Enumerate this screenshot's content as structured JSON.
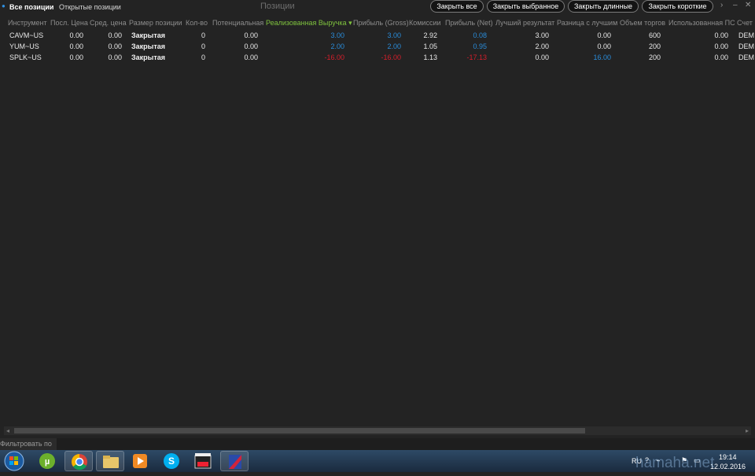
{
  "tabs": [
    {
      "label": "Все позиции"
    },
    {
      "label": "Открытые позиции"
    }
  ],
  "window_title": "Позиции",
  "actions": [
    {
      "label": "Закрыть все"
    },
    {
      "label": "Закрыть выбранное"
    },
    {
      "label": "Закрыть длинные"
    },
    {
      "label": "Закрыть короткие"
    }
  ],
  "columns": [
    "Инструмент",
    "Посл. Цена",
    "Сред. цена",
    "Размер позиции",
    "Кол-во",
    "Потенциальная",
    "Реализованная Выручка",
    "Прибыль (Gross)",
    "Комиссии",
    "Прибыль (Net)",
    "Лучший результат",
    "Разница с лучшим",
    "Объем торгов",
    "Использованная ПС",
    "Счет"
  ],
  "rows": [
    [
      "CAVM~US",
      "0.00",
      "0.00",
      "Закрытая",
      "0",
      "0.00",
      "3.00",
      "3.00",
      "2.92",
      "0.08",
      "3.00",
      "0.00",
      "600",
      "0.00",
      "DEM"
    ],
    [
      "YUM~US",
      "0.00",
      "0.00",
      "Закрытая",
      "0",
      "0.00",
      "2.00",
      "2.00",
      "1.05",
      "0.95",
      "2.00",
      "0.00",
      "200",
      "0.00",
      "DEM"
    ],
    [
      "SPLK~US",
      "0.00",
      "0.00",
      "Закрытая",
      "0",
      "0.00",
      "-16.00",
      "-16.00",
      "1.13",
      "-17.13",
      "0.00",
      "16.00",
      "200",
      "0.00",
      "DEM"
    ]
  ],
  "filter": {
    "label": "Фильтровать по"
  },
  "tray": {
    "lang": "RU",
    "time": "19:14",
    "date": "12.02.2016"
  },
  "watermark": "hamaha.net",
  "colors": {
    "positive": "#2a8bd8",
    "negative": "#d41e2b",
    "sorted_header": "#7fc23e"
  }
}
